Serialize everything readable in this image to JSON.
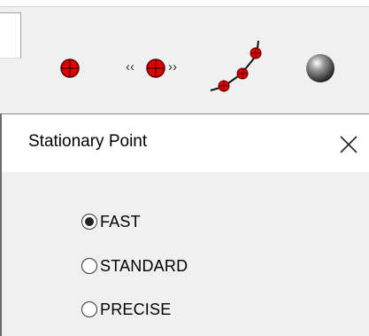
{
  "toolbar": {
    "buttons": [
      {
        "icon": "point-marker-icon"
      },
      {
        "icon": "stationary-point-arrows-icon",
        "glyph_left": "‹‹",
        "glyph_right": "››"
      },
      {
        "icon": "point-path-icon"
      },
      {
        "icon": "sphere-icon"
      }
    ],
    "colors": {
      "marker_red": "#e00000",
      "marker_outline": "#600000",
      "sphere": "#5a5a5a"
    }
  },
  "dialog": {
    "title": "Stationary Point",
    "close_glyph": "✕",
    "options": [
      {
        "label": "FAST",
        "selected": true
      },
      {
        "label": "STANDARD",
        "selected": false
      },
      {
        "label": "PRECISE",
        "selected": false
      }
    ]
  }
}
